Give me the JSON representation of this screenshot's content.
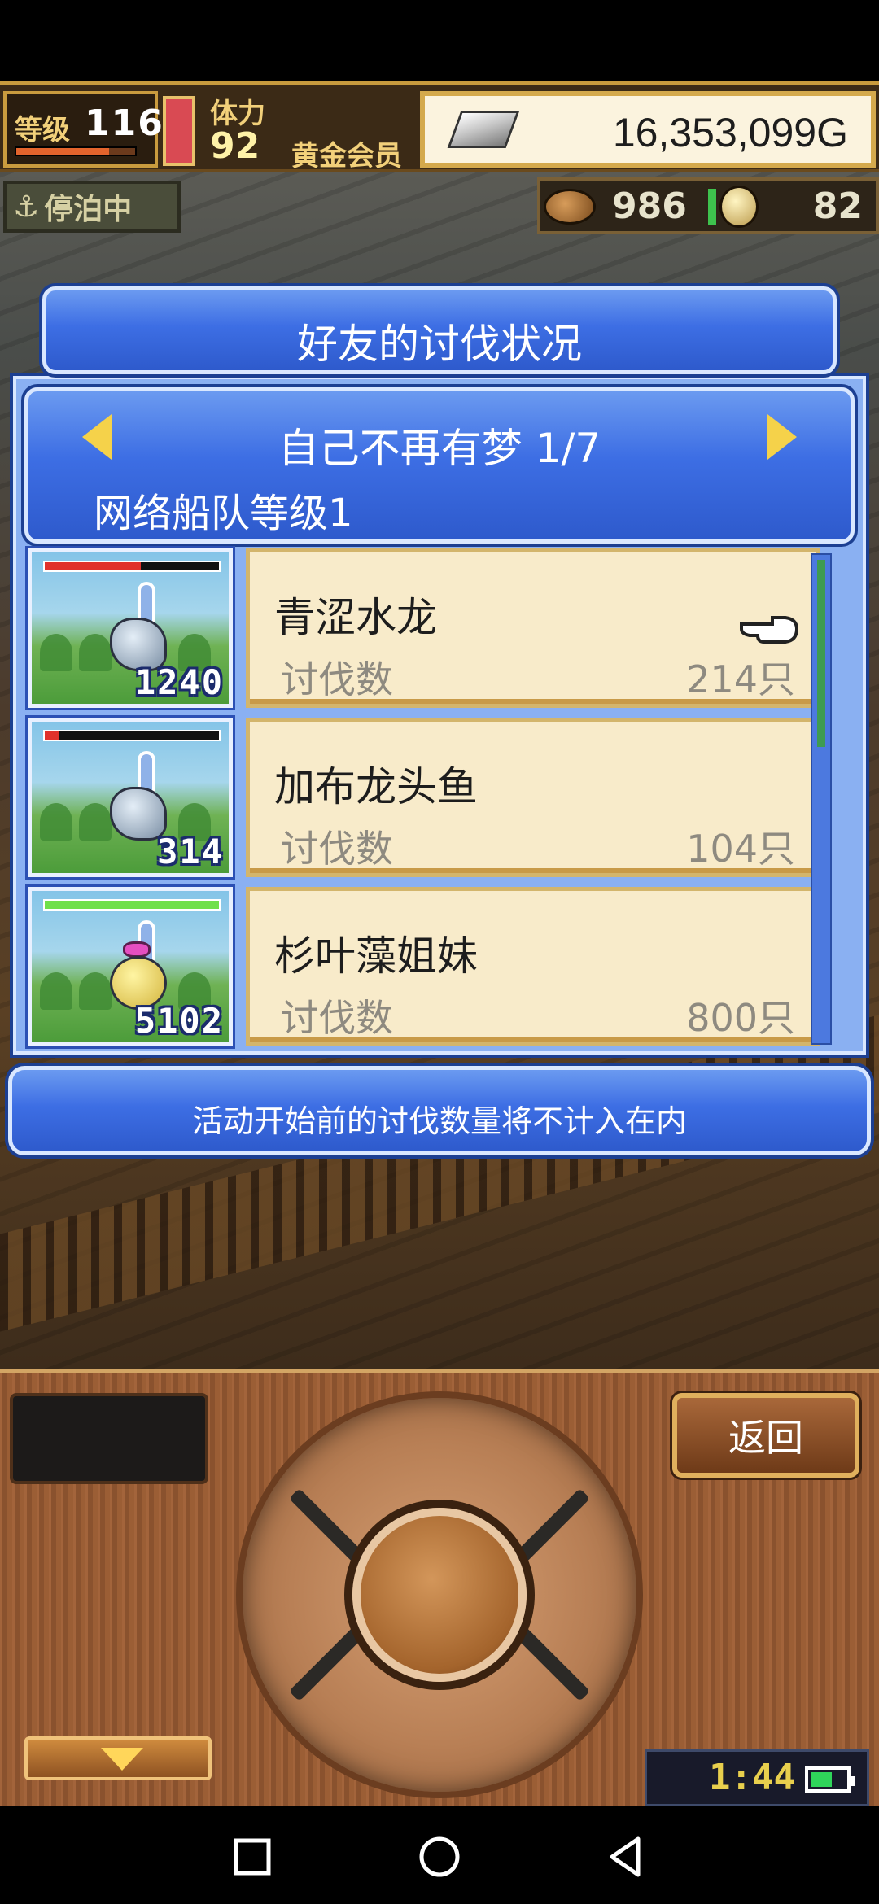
{
  "hud": {
    "level_label": "等级",
    "level_value": "116",
    "stamina_label": "体力",
    "stamina_value": "92",
    "member_label": "黄金会员",
    "gold_value": "16,353,099G",
    "docked_label": "停泊中",
    "food_value": "986",
    "coin_value": "82"
  },
  "dialog": {
    "title": "好友的讨伐状况",
    "friend_name": "自己不再有梦 1/7",
    "fleet_level": "网络船队等级1",
    "note": "活动开始前的讨伐数量将不计入在内"
  },
  "monsters": [
    {
      "name": "青涩水龙",
      "kill_label": "讨伐数",
      "kill_count": "214只",
      "number": "1240",
      "hp_fraction": 0.55,
      "hp_color": "#e0312b"
    },
    {
      "name": "加布龙头鱼",
      "kill_label": "讨伐数",
      "kill_count": "104只",
      "number": "314",
      "hp_fraction": 0.08,
      "hp_color": "#e0312b"
    },
    {
      "name": "杉叶藻姐妹",
      "kill_label": "讨伐数",
      "kill_count": "800只",
      "number": "5102",
      "hp_fraction": 1.0,
      "hp_color": "#6fe04a"
    }
  ],
  "controls": {
    "back_label": "返回",
    "clock": "1:44",
    "battery_fraction": 0.6
  },
  "icons": {
    "docked": "anchor-icon",
    "pointer": "pointing-hand-icon",
    "nav_recent": "square-icon",
    "nav_home": "circle-icon",
    "nav_back": "triangle-back-icon"
  },
  "colors": {
    "panel_blue": "#3d6ee4",
    "card_beige": "#f8ebca",
    "gold_accent": "#d8b24b"
  }
}
